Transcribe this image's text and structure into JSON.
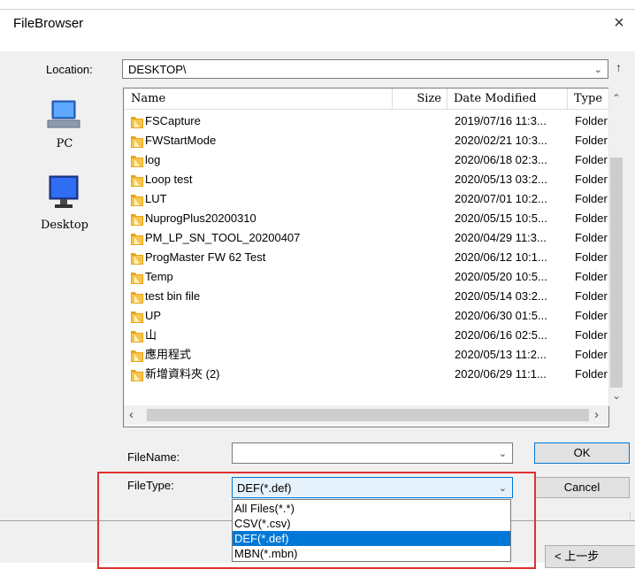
{
  "window": {
    "title": "FileBrowser",
    "close_glyph": "×"
  },
  "location": {
    "label": "Location:",
    "value": "DESKTOP\\"
  },
  "places": [
    {
      "label": "PC",
      "icon": "pc-icon"
    },
    {
      "label": "Desktop",
      "icon": "desktop-icon"
    }
  ],
  "columns": {
    "name": "Name",
    "size": "Size",
    "date": "Date Modified",
    "type": "Type"
  },
  "files": [
    {
      "name": "FSCapture",
      "date": "2019/07/16 11:3...",
      "type": "Folder"
    },
    {
      "name": "FWStartMode",
      "date": "2020/02/21 10:3...",
      "type": "Folder"
    },
    {
      "name": "log",
      "date": "2020/06/18 02:3...",
      "type": "Folder"
    },
    {
      "name": "Loop test",
      "date": "2020/05/13 03:2...",
      "type": "Folder"
    },
    {
      "name": "LUT",
      "date": "2020/07/01 10:2...",
      "type": "Folder"
    },
    {
      "name": "NuprogPlus20200310",
      "date": "2020/05/15 10:5...",
      "type": "Folder"
    },
    {
      "name": "PM_LP_SN_TOOL_20200407",
      "date": "2020/04/29 11:3...",
      "type": "Folder"
    },
    {
      "name": "ProgMaster FW 62 Test",
      "date": "2020/06/12 10:1...",
      "type": "Folder"
    },
    {
      "name": "Temp",
      "date": "2020/05/20 10:5...",
      "type": "Folder"
    },
    {
      "name": "test bin file",
      "date": "2020/05/14 03:2...",
      "type": "Folder"
    },
    {
      "name": "UP",
      "date": "2020/06/30 01:5...",
      "type": "Folder"
    },
    {
      "name": "山",
      "date": "2020/06/16 02:5...",
      "type": "Folder"
    },
    {
      "name": "應用程式",
      "date": "2020/05/13 11:2...",
      "type": "Folder"
    },
    {
      "name": "新增資料夾 (2)",
      "date": "2020/06/29 11:1...",
      "type": "Folder"
    }
  ],
  "filename": {
    "label": "FileName:",
    "value": ""
  },
  "filetype": {
    "label": "FileType:",
    "value": "DEF(*.def)",
    "options": [
      "All Files(*.*)",
      "CSV(*.csv)",
      "DEF(*.def)",
      "MBN(*.mbn)"
    ],
    "selected_index": 2
  },
  "buttons": {
    "ok": "OK",
    "cancel": "Cancel",
    "back": "< 上一步"
  },
  "colors": {
    "highlight": "#0078d7",
    "annotation": "#e03030",
    "folder": "#e8a317"
  }
}
